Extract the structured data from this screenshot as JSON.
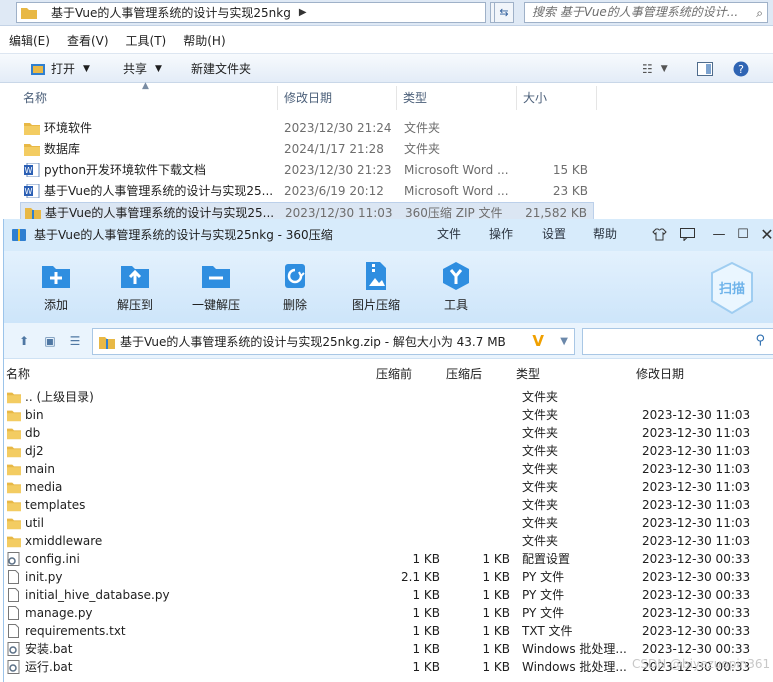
{
  "explorer": {
    "breadcrumb": "基于Vue的人事管理系统的设计与实现25nkg",
    "search_placeholder": "搜索 基于Vue的人事管理系统的设计...",
    "menu": [
      "编辑(E)",
      "查看(V)",
      "工具(T)",
      "帮助(H)"
    ],
    "toolbar": {
      "open": "打开",
      "share": "共享",
      "new_folder": "新建文件夹"
    },
    "columns": {
      "name": "名称",
      "date": "修改日期",
      "type": "类型",
      "size": "大小"
    },
    "files": [
      {
        "name": "环境软件",
        "date": "2023/12/30 21:24",
        "type": "文件夹",
        "size": "",
        "icon": "folder-icon"
      },
      {
        "name": "数据库",
        "date": "2024/1/17 21:28",
        "type": "文件夹",
        "size": "",
        "icon": "folder-icon"
      },
      {
        "name": "python开发环境软件下载文档",
        "date": "2023/12/30 21:23",
        "type": "Microsoft Word ...",
        "size": "15 KB",
        "icon": "word-icon"
      },
      {
        "name": "基于Vue的人事管理系统的设计与实现25...",
        "date": "2023/6/19 20:12",
        "type": "Microsoft Word ...",
        "size": "23 KB",
        "icon": "word-icon"
      },
      {
        "name": "基于Vue的人事管理系统的设计与实现25...",
        "date": "2023/12/30 11:03",
        "type": "360压缩 ZIP 文件",
        "size": "21,582 KB",
        "icon": "zip-icon",
        "selected": true
      }
    ]
  },
  "zip": {
    "title": "基于Vue的人事管理系统的设计与实现25nkg - 360压缩",
    "menu": [
      "文件",
      "操作",
      "设置",
      "帮助"
    ],
    "tools": [
      "添加",
      "解压到",
      "一键解压",
      "删除",
      "图片压缩",
      "工具"
    ],
    "scan_label": "扫描",
    "path": "基于Vue的人事管理系统的设计与实现25nkg.zip - 解包大小为 43.7 MB",
    "columns": {
      "name": "名称",
      "before": "压缩前",
      "after": "压缩后",
      "type": "类型",
      "modified": "修改日期"
    },
    "entries": [
      {
        "name": ".. (上级目录)",
        "before": "",
        "after": "",
        "type": "文件夹",
        "modified": "",
        "icon": "folder-icon"
      },
      {
        "name": "bin",
        "before": "",
        "after": "",
        "type": "文件夹",
        "modified": "2023-12-30 11:03",
        "icon": "folder-icon"
      },
      {
        "name": "db",
        "before": "",
        "after": "",
        "type": "文件夹",
        "modified": "2023-12-30 11:03",
        "icon": "folder-icon"
      },
      {
        "name": "dj2",
        "before": "",
        "after": "",
        "type": "文件夹",
        "modified": "2023-12-30 11:03",
        "icon": "folder-icon"
      },
      {
        "name": "main",
        "before": "",
        "after": "",
        "type": "文件夹",
        "modified": "2023-12-30 11:03",
        "icon": "folder-icon"
      },
      {
        "name": "media",
        "before": "",
        "after": "",
        "type": "文件夹",
        "modified": "2023-12-30 11:03",
        "icon": "folder-icon"
      },
      {
        "name": "templates",
        "before": "",
        "after": "",
        "type": "文件夹",
        "modified": "2023-12-30 11:03",
        "icon": "folder-icon"
      },
      {
        "name": "util",
        "before": "",
        "after": "",
        "type": "文件夹",
        "modified": "2023-12-30 11:03",
        "icon": "folder-icon"
      },
      {
        "name": "xmiddleware",
        "before": "",
        "after": "",
        "type": "文件夹",
        "modified": "2023-12-30 11:03",
        "icon": "folder-icon"
      },
      {
        "name": "config.ini",
        "before": "1 KB",
        "after": "1 KB",
        "type": "配置设置",
        "modified": "2023-12-30 00:33",
        "icon": "config-file-icon"
      },
      {
        "name": "init.py",
        "before": "2.1 KB",
        "after": "1 KB",
        "type": "PY 文件",
        "modified": "2023-12-30 00:33",
        "icon": "file-icon"
      },
      {
        "name": "initial_hive_database.py",
        "before": "1 KB",
        "after": "1 KB",
        "type": "PY 文件",
        "modified": "2023-12-30 00:33",
        "icon": "file-icon"
      },
      {
        "name": "manage.py",
        "before": "1 KB",
        "after": "1 KB",
        "type": "PY 文件",
        "modified": "2023-12-30 00:33",
        "icon": "file-icon"
      },
      {
        "name": "requirements.txt",
        "before": "1 KB",
        "after": "1 KB",
        "type": "TXT 文件",
        "modified": "2023-12-30 00:33",
        "icon": "file-icon"
      },
      {
        "name": "安装.bat",
        "before": "1 KB",
        "after": "1 KB",
        "type": "Windows 批处理...",
        "modified": "2023-12-30 00:33",
        "icon": "bat-file-icon"
      },
      {
        "name": "运行.bat",
        "before": "1 KB",
        "after": "1 KB",
        "type": "Windows 批处理...",
        "modified": "2023-12-30 00:33",
        "icon": "bat-file-icon"
      }
    ]
  },
  "watermark": "CSDN @biyezuopin361",
  "colors": {
    "zip_title_bg": "#d7ebfb",
    "zip_toolbar_bg": "#cde5fa",
    "folder": "#e8b845",
    "selected_row": "#dbe6f3",
    "accent_blue": "#2f7fd0"
  }
}
